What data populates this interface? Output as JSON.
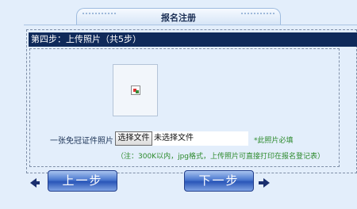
{
  "header": {
    "title": "报名注册"
  },
  "step": {
    "label": "第四步：上传照片（共5步）"
  },
  "upload": {
    "photo_label": "一张免冠证件照片",
    "choose_button": "选择文件",
    "no_file_text": "未选择文件",
    "required_note": "*此照片必填",
    "format_note": "（注：300K以内，jpg格式，上传照片可直接打印在报名登记表）"
  },
  "nav": {
    "prev_label": "上一步",
    "next_label": "下一步"
  },
  "icons": [
    "broken-image-icon",
    "arrow-left-icon",
    "arrow-right-icon"
  ],
  "colors": {
    "step_bar": "#0f2a5a",
    "note_green": "#2c8a2c",
    "button_blue": "#2a56b8"
  }
}
